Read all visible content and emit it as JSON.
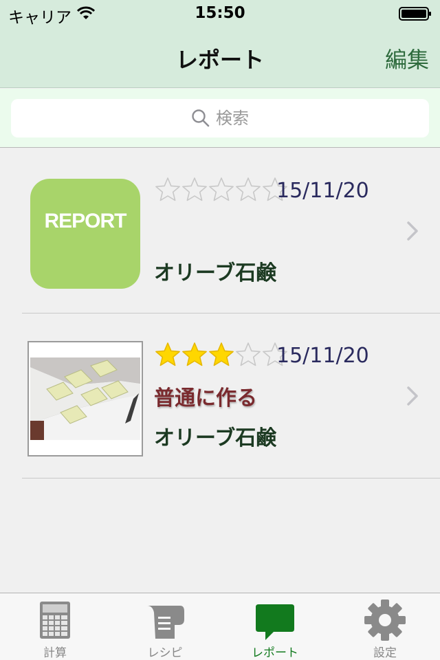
{
  "status_bar": {
    "carrier": "キャリア",
    "time": "15:50"
  },
  "nav": {
    "title": "レポート",
    "edit_label": "編集"
  },
  "search": {
    "placeholder": "検索"
  },
  "reports": [
    {
      "thumbnail": "report-placeholder",
      "thumbnail_text": "REPORT",
      "rating": 0,
      "max_rating": 5,
      "date": "15/11/20",
      "subtitle": "",
      "title": "オリーブ石鹸"
    },
    {
      "thumbnail": "soap-photo",
      "rating": 3,
      "max_rating": 5,
      "date": "15/11/20",
      "subtitle": "普通に作る",
      "title": "オリーブ石鹸"
    }
  ],
  "tabs": [
    {
      "label": "計算",
      "icon": "calculator-icon",
      "active": false
    },
    {
      "label": "レシピ",
      "icon": "recipe-icon",
      "active": false
    },
    {
      "label": "レポート",
      "icon": "speech-bubble-icon",
      "active": true
    },
    {
      "label": "設定",
      "icon": "gear-icon",
      "active": false
    }
  ],
  "colors": {
    "nav_background": "#d6ebdc",
    "accent": "#127a1e",
    "report_thumb": "#a8d46a",
    "star_filled": "#ffd700",
    "subtitle": "#7a2a2e"
  }
}
